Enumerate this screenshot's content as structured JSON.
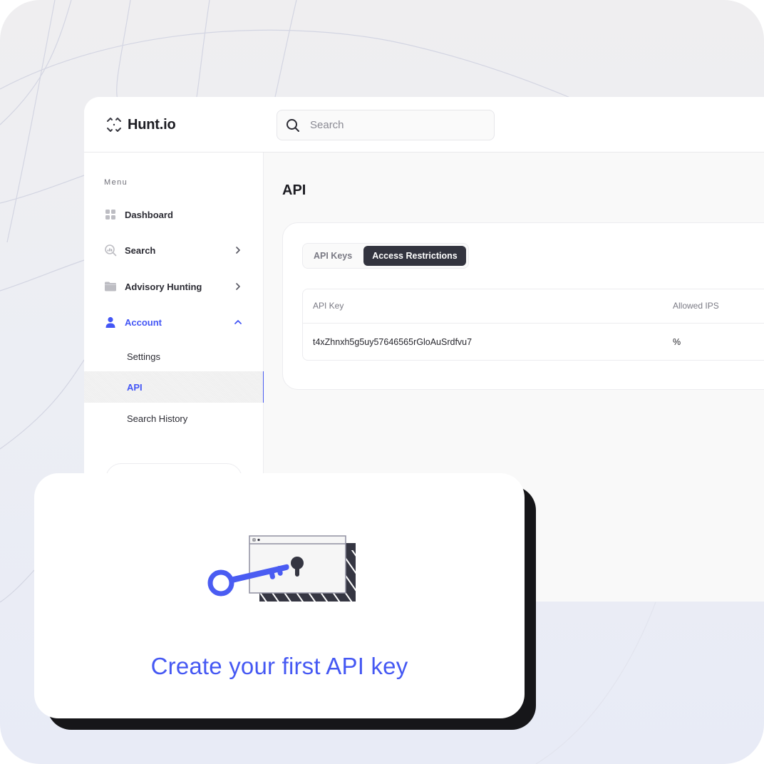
{
  "app": {
    "logo_text": "Hunt.io",
    "logo_icon": "crosshair-arrows-icon"
  },
  "search": {
    "placeholder": "Search",
    "value": "",
    "icon": "search-icon"
  },
  "sidebar": {
    "menu_label": "Menu",
    "items": [
      {
        "label": "Dashboard",
        "icon": "dashboard-grid-icon",
        "has_chevron": false,
        "active": false
      },
      {
        "label": "Search",
        "icon": "search-analytics-icon",
        "has_chevron": true,
        "chevron": "chevron-right",
        "active": false
      },
      {
        "label": "Advisory Hunting",
        "icon": "folder-icon",
        "has_chevron": true,
        "chevron": "chevron-right",
        "active": false
      },
      {
        "label": "Account",
        "icon": "user-icon",
        "has_chevron": true,
        "chevron": "chevron-up",
        "active": true
      }
    ],
    "sub_items": [
      {
        "label": "Settings",
        "active": false
      },
      {
        "label": "API",
        "active": true
      },
      {
        "label": "Search History",
        "active": false
      }
    ]
  },
  "main": {
    "title": "API",
    "tabs": [
      {
        "label": "API Keys",
        "active": false
      },
      {
        "label": "Access Restrictions",
        "active": true
      }
    ],
    "table": {
      "columns": [
        "API Key",
        "Allowed IPS"
      ],
      "rows": [
        [
          "t4xZhnxh5g5uy57646565rGloAuSrdfvu7",
          "%"
        ]
      ]
    }
  },
  "cta": {
    "text": "Create your first API key",
    "illustration": "key-and-keyhole-window-illustration"
  },
  "colors": {
    "accent": "#4558f3",
    "dark": "#33343f",
    "shadow": "#161619"
  }
}
